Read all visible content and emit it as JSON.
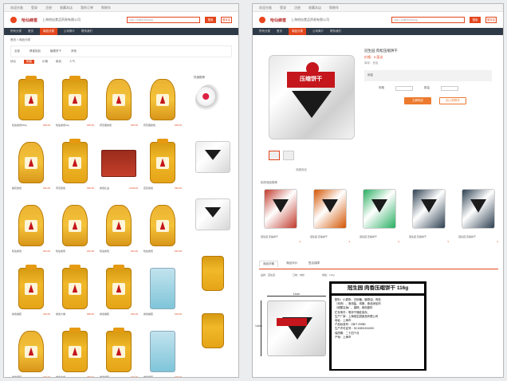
{
  "window1": {
    "topbar": [
      "欢迎光临",
      "登录",
      "注册",
      "收藏本店",
      "我的订单",
      "购物车"
    ],
    "brand": "哈仙蜂蜜",
    "shop_name": "上海哈仙食品贸易有限公司",
    "search_placeholder": "请输入您要搜索的商品",
    "search_button": "搜索",
    "search_shop_button": "搜本店",
    "nav": [
      "所有分类",
      "首页",
      "商品分类",
      "公司简介",
      "联系我们"
    ],
    "nav_active": "商品分类",
    "breadcrumb": "首页 > 商品分类",
    "filter_tags": [
      "全部",
      "蜂蜜制品",
      "糖果饼干",
      "其他"
    ],
    "sort": [
      "综合",
      "销量",
      "价格",
      "新品",
      "人气"
    ],
    "sort_active": "销量",
    "sidebar_title": "热销推荐",
    "products": [
      {
        "kind": "jar",
        "name": "哈仙蜂蜜500g",
        "price": "¥28.00"
      },
      {
        "kind": "jar",
        "name": "哈仙蜂蜜1kg",
        "price": "¥45.00"
      },
      {
        "kind": "bottle",
        "name": "挤压瓶蜂蜜",
        "price": "¥25.00"
      },
      {
        "kind": "bottle",
        "name": "挤压瓶蜂蜜",
        "price": "¥25.00"
      },
      {
        "kind": "bottle",
        "name": "槐花蜂蜜",
        "price": "¥32.00"
      },
      {
        "kind": "jar",
        "name": "枣花蜂蜜",
        "price": "¥36.00"
      },
      {
        "kind": "box",
        "name": "蜂蜜礼盒",
        "price": "¥128.00"
      },
      {
        "kind": "jar",
        "name": "百花蜂蜜",
        "price": "¥30.00"
      },
      {
        "kind": "bottle",
        "name": "哈仙蜂蜜",
        "price": "¥22.00"
      },
      {
        "kind": "bottle",
        "name": "哈仙蜂蜜",
        "price": "¥22.00"
      },
      {
        "kind": "bottle",
        "name": "哈仙蜂蜜",
        "price": "¥22.00"
      },
      {
        "kind": "bottle",
        "name": "哈仙蜂蜜",
        "price": "¥22.00"
      },
      {
        "kind": "jar",
        "name": "蜂蜜罐装",
        "price": "¥40.00"
      },
      {
        "kind": "jar",
        "name": "蜂蜜大罐",
        "price": "¥68.00"
      },
      {
        "kind": "jar",
        "name": "蜂蜜罐装",
        "price": "¥40.00"
      },
      {
        "kind": "blue",
        "name": "蜂蜜袋装",
        "price": "¥15.00"
      },
      {
        "kind": "bottle",
        "name": "蜂蜜瓶装",
        "price": "¥26.00"
      },
      {
        "kind": "jar",
        "name": "蜂蜜大罐",
        "price": "¥68.00"
      },
      {
        "kind": "jar",
        "name": "蜂蜜罐装",
        "price": "¥40.00"
      },
      {
        "kind": "blue",
        "name": "蜂蜜袋装",
        "price": "¥15.00"
      }
    ],
    "sidebar_items": [
      {
        "kind": "candy"
      },
      {
        "kind": "pack"
      },
      {
        "kind": "pack"
      },
      {
        "kind": "jar"
      },
      {
        "kind": "jar"
      }
    ]
  },
  "window2": {
    "product_title": "冠生园 肉松压缩饼干",
    "price": "价格：¥ 面议",
    "stock": "库存：充足",
    "gray_text": "销量",
    "qty_label": "数量",
    "spec_label": "规格",
    "btn_buy": "立即购买",
    "btn_cart": "加入购物车",
    "favorite": "收藏商品",
    "related_title": "相关商品推荐",
    "related": [
      {
        "color": "#c0392b",
        "name": "冠生园 压缩饼干",
        "price": "¥"
      },
      {
        "color": "#d35400",
        "name": "冠生园 压缩饼干",
        "price": "¥"
      },
      {
        "color": "#27ae60",
        "name": "冠生园 压缩饼干",
        "price": "¥"
      },
      {
        "color": "#2c3e50",
        "name": "冠生园 压缩饼干",
        "price": "¥"
      },
      {
        "color": "#2c3e50",
        "name": "冠生园 压缩饼干",
        "price": "¥"
      }
    ],
    "tabs": [
      "商品详情",
      "商品评价",
      "售后保障"
    ],
    "attrs": [
      "品牌：冠生园",
      "口味：肉松",
      "规格：116g"
    ],
    "dim_w": "14cm",
    "dim_h": "14cm",
    "spec_title": "冠生园 肉香压缩饼干 116g",
    "spec_lines": [
      "配料：小麦粉、白砂糖、植物油、肉松",
      "（鸡肉）、食用盐、鸡蛋、食品添加剂",
      "（碳酸氢钠）、香精、食用香料",
      "贮存条件：阴凉干燥处保存。",
      "生产厂家：上海冠生园食品有限公司",
      "地址：上海市",
      "产品标准号：GB/T 20980",
      "生产许可证号：SC10831011000",
      "保质期：二十四个月",
      "产地：上海市"
    ],
    "banner_brand": "冠生园",
    "banner_text": "压缩饼干"
  }
}
